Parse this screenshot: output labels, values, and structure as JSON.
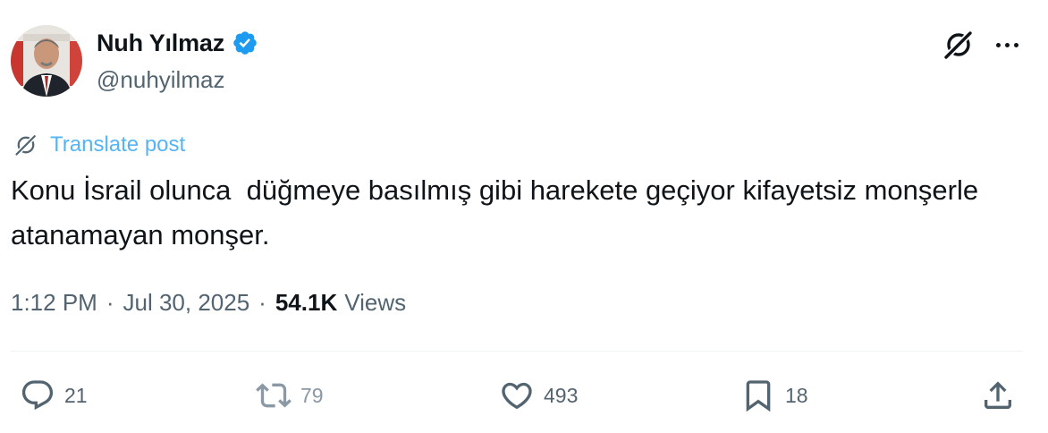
{
  "author": {
    "display_name": "Nuh Yılmaz",
    "handle": "@nuhyilmaz",
    "verified": true,
    "avatar_icon": "profile-photo"
  },
  "header_actions": {
    "grok_icon": "grok-icon",
    "more_icon": "more-options-icon"
  },
  "translate": {
    "label": "Translate post",
    "icon": "translate-icon"
  },
  "tweet": {
    "text": "Konu İsrail olunca  düğmeye basılmış gibi harekete geçiyor kifayetsiz monşerle atanamayan monşer."
  },
  "meta": {
    "time": "1:12 PM",
    "separator": "·",
    "date": "Jul 30, 2025",
    "views_count": "54.1K",
    "views_label": "Views"
  },
  "actions": {
    "reply": {
      "count": "21",
      "icon": "reply-icon"
    },
    "repost": {
      "count": "79",
      "icon": "repost-icon"
    },
    "like": {
      "count": "493",
      "icon": "heart-icon"
    },
    "bookmark": {
      "count": "18",
      "icon": "bookmark-icon"
    },
    "share": {
      "icon": "share-icon"
    }
  },
  "colors": {
    "accent": "#1d9bf0",
    "text_primary": "#0f1419",
    "text_secondary": "#536471",
    "divider": "#eff3f4"
  }
}
